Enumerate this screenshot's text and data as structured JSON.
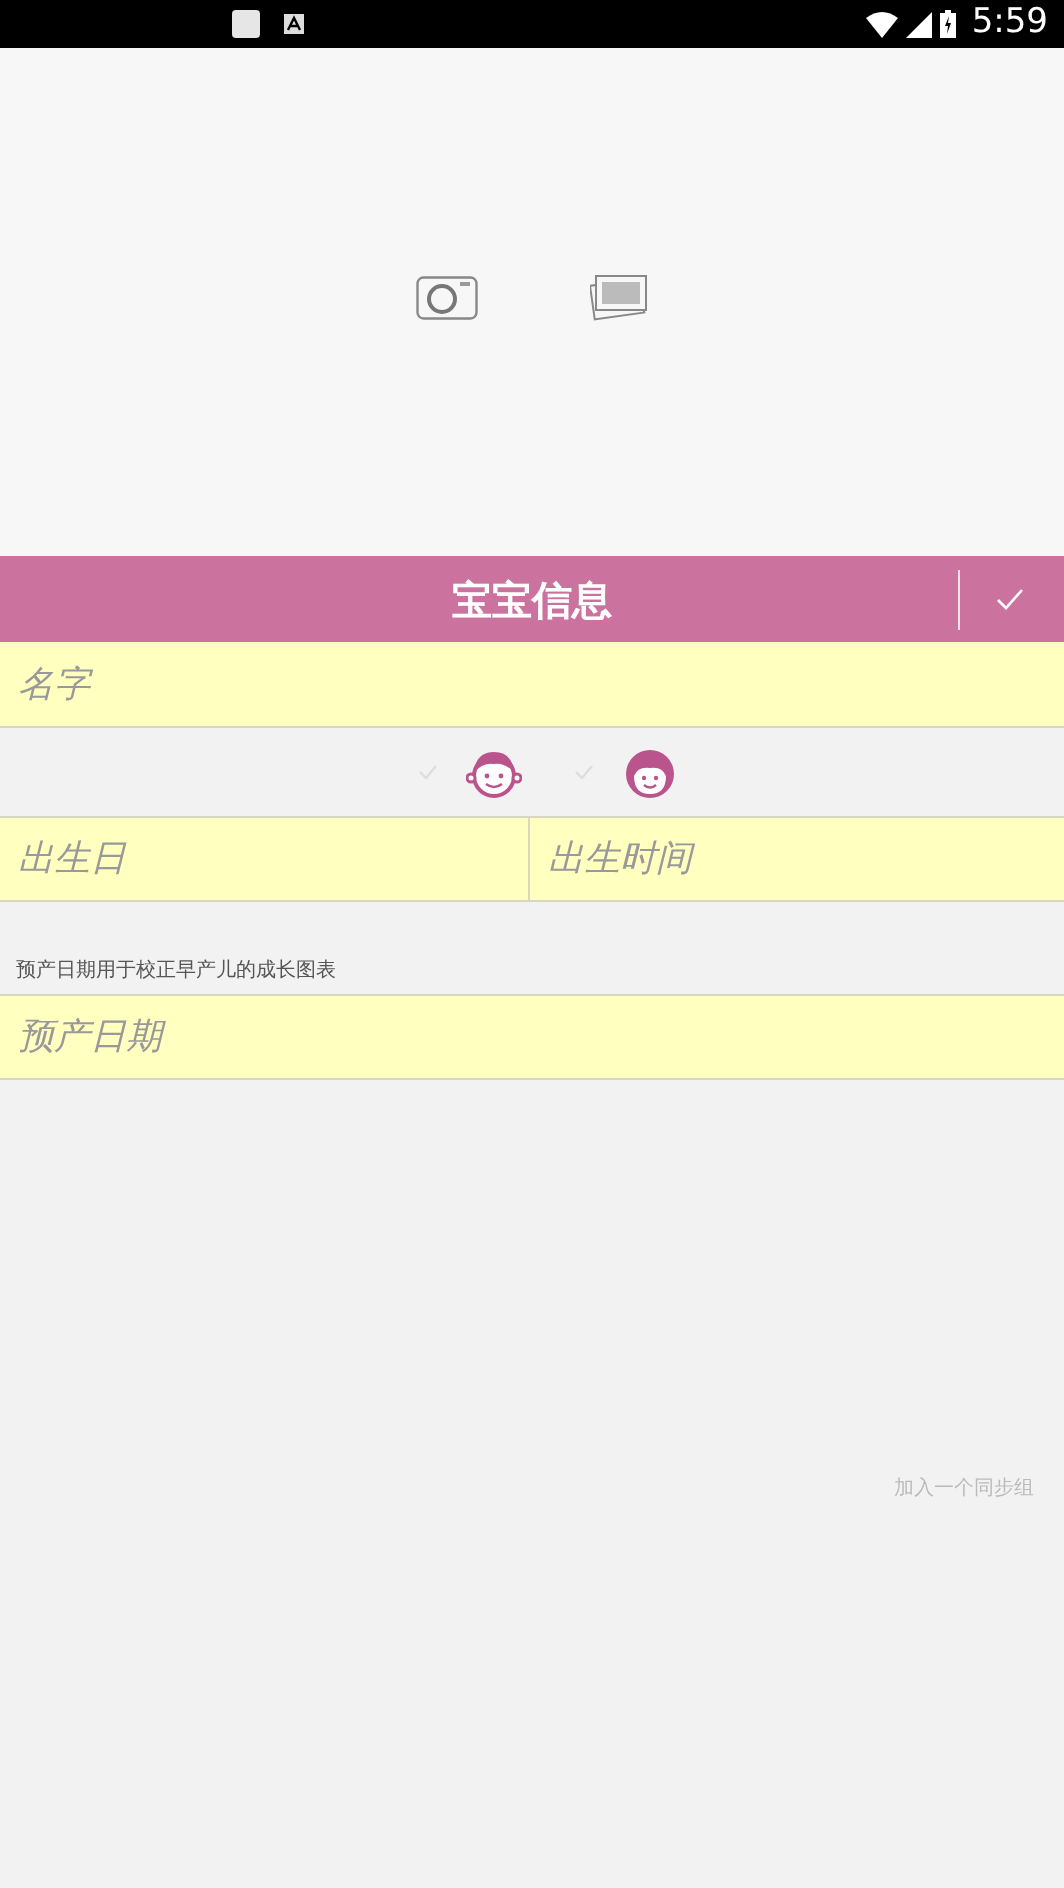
{
  "status_bar": {
    "time": "5:59"
  },
  "header": {
    "title": "宝宝信息"
  },
  "name_field": {
    "placeholder": "名字"
  },
  "gender": [
    {
      "kind": "boy",
      "selected": false
    },
    {
      "kind": "girl",
      "selected": false
    }
  ],
  "birth": [
    {
      "placeholder": "出生日"
    },
    {
      "placeholder": "出生时间"
    }
  ],
  "due_date": {
    "hint": "预产日期用于校正早产儿的成长图表",
    "placeholder": "预产日期"
  },
  "sync_link": "加入一个同步组"
}
